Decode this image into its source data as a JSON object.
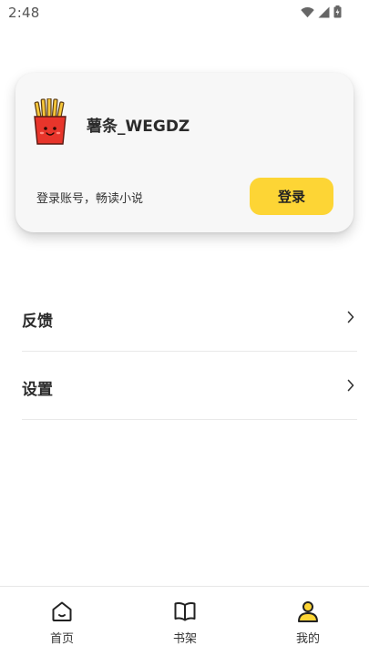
{
  "status_bar": {
    "time": "2:48",
    "icons": [
      "wifi-icon",
      "cellular-signal-icon",
      "battery-charging-icon"
    ]
  },
  "profile": {
    "avatar_icon": "french-fries-avatar",
    "username": "薯条_WEGDZ",
    "login_hint": "登录账号，畅读小说",
    "login_button_label": "登录",
    "accent_color": "#fdd535"
  },
  "menu": {
    "items": [
      {
        "label": "反馈",
        "icon": "chevron-right-icon"
      },
      {
        "label": "设置",
        "icon": "chevron-right-icon"
      }
    ]
  },
  "bottom_nav": {
    "items": [
      {
        "label": "首页",
        "icon": "home-icon",
        "active": false
      },
      {
        "label": "书架",
        "icon": "open-book-icon",
        "active": false
      },
      {
        "label": "我的",
        "icon": "user-icon",
        "active": true
      }
    ],
    "active_color": "#fdd535"
  }
}
